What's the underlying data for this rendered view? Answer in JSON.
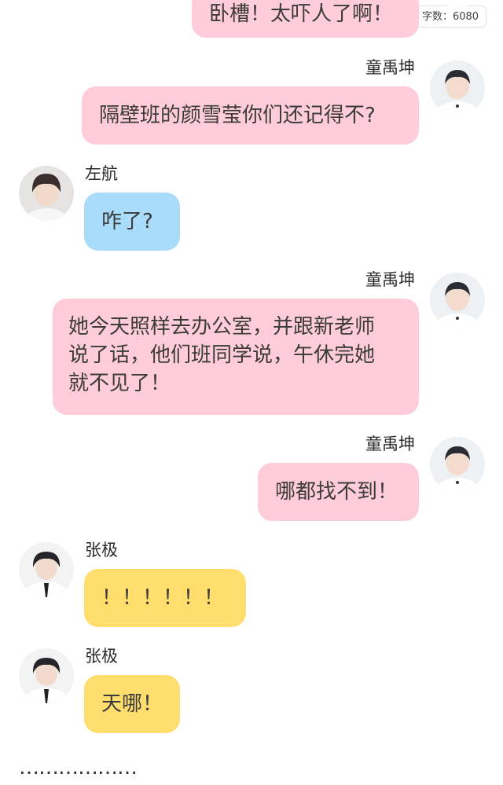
{
  "word_count": {
    "label": "字数：",
    "value": "6080"
  },
  "messages": [
    {
      "sender": "",
      "side": "right",
      "color": "pink",
      "text": "卧槽！太吓人了啊！",
      "avatar_icon": "boy-avatar-icon"
    },
    {
      "sender": "童禹坤",
      "side": "right",
      "color": "pink",
      "text": "隔壁班的颜雪莹你们还记得不?",
      "avatar_icon": "boy-avatar-icon"
    },
    {
      "sender": "左航",
      "side": "left",
      "color": "blue",
      "text": "咋了?",
      "avatar_icon": "boy-avatar-icon"
    },
    {
      "sender": "童禹坤",
      "side": "right",
      "color": "pink",
      "text_lines": [
        "她今天照样去办公室，并跟新老师",
        "说了话，他们班同学说，午休完她",
        "就不见了！"
      ],
      "avatar_icon": "boy-avatar-icon"
    },
    {
      "sender": "童禹坤",
      "side": "right",
      "color": "pink",
      "text": "哪都找不到！",
      "avatar_icon": "boy-avatar-icon"
    },
    {
      "sender": "张极",
      "side": "left",
      "color": "yellow",
      "text": "！！！！！！",
      "avatar_icon": "boy-avatar-icon"
    },
    {
      "sender": "张极",
      "side": "left",
      "color": "yellow",
      "text": "天哪！",
      "avatar_icon": "boy-avatar-icon"
    }
  ],
  "footer": {
    "ellipsis": "………………"
  },
  "colors": {
    "pink": "#ffcdd9",
    "blue": "#a9dcfa",
    "yellow": "#ffde6e"
  }
}
